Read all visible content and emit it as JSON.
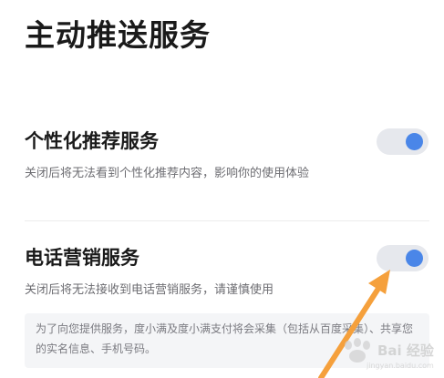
{
  "page": {
    "title": "主动推送服务"
  },
  "settings": [
    {
      "title": "个性化推荐服务",
      "description": "关闭后将无法看到个性化推荐内容，影响你的使用体验",
      "enabled": true
    },
    {
      "title": "电话营销服务",
      "description": "关闭后将无法接收到电话营销服务，请谨慎使用",
      "enabled": true
    }
  ],
  "notice": {
    "text": "为了向您提供服务，度小满及度小满支付将会采集（包括从百度采集）、共享您的实名信息、手机号码。"
  },
  "colors": {
    "toggle_track": "#e6e8ed",
    "toggle_knob": "#4a86e8",
    "annotation_arrow": "#f5a03c",
    "notice_background": "#f4f5f7"
  },
  "icons": {
    "annotation": "arrow-pointer-icon"
  },
  "watermark": {
    "text": "Bai 经验",
    "url": "jingyan.baidu.com"
  }
}
